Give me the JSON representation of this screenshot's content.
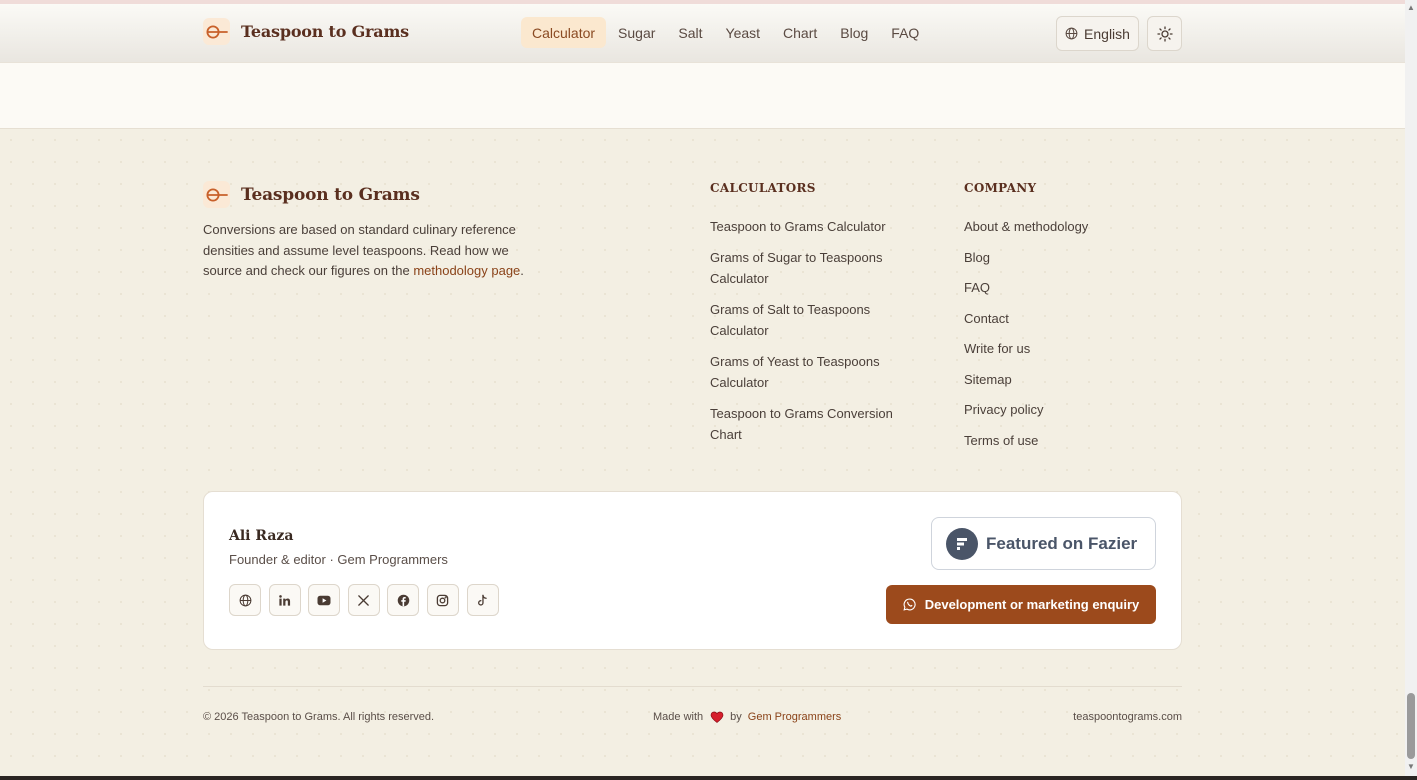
{
  "header": {
    "brand": "Teaspoon to Grams",
    "nav": [
      {
        "label": "Calculator",
        "active": true
      },
      {
        "label": "Sugar",
        "active": false
      },
      {
        "label": "Salt",
        "active": false
      },
      {
        "label": "Yeast",
        "active": false
      },
      {
        "label": "Chart",
        "active": false
      },
      {
        "label": "Blog",
        "active": false
      },
      {
        "label": "FAQ",
        "active": false
      }
    ],
    "language": "English",
    "icons": {
      "language": "globe-icon",
      "theme": "sun-icon"
    }
  },
  "footer": {
    "brand": "Teaspoon to Grams",
    "description_text": "Conversions are based on standard culinary reference densities and assume level teaspoons. Read how we source and check our figures on the",
    "description_link": "methodology page",
    "description_end": ".",
    "calculators": {
      "title": "CALCULATORS",
      "links": [
        "Teaspoon to Grams Calculator",
        "Grams of Sugar to Teaspoons Calculator",
        "Grams of Salt to Teaspoons Calculator",
        "Grams of Yeast to Teaspoons Calculator",
        "Teaspoon to Grams Conversion Chart"
      ]
    },
    "company": {
      "title": "COMPANY",
      "links": [
        "About & methodology",
        "Blog",
        "FAQ",
        "Contact",
        "Write for us",
        "Sitemap",
        "Privacy policy",
        "Terms of use"
      ]
    },
    "author": {
      "name": "Ali Raza",
      "role": "Founder & editor · Gem Programmers",
      "socials": [
        "globe-icon",
        "linkedin-icon",
        "youtube-icon",
        "x-icon",
        "facebook-icon",
        "instagram-icon",
        "tiktok-icon"
      ]
    },
    "fazier_badge": "Featured on Fazier",
    "enquiry_button": "Development or marketing enquiry",
    "copyright": "© 2026 Teaspoon to Grams. All rights reserved.",
    "made_with": "Made with",
    "by": "by",
    "made_by_link": "Gem Programmers",
    "domain": "teaspoontograms.com"
  },
  "colors": {
    "accent": "#9c4a1c",
    "brand_text": "#5a2f1f",
    "footer_bg": "#f3efe3",
    "nav_active_bg": "#fbe8cf"
  }
}
